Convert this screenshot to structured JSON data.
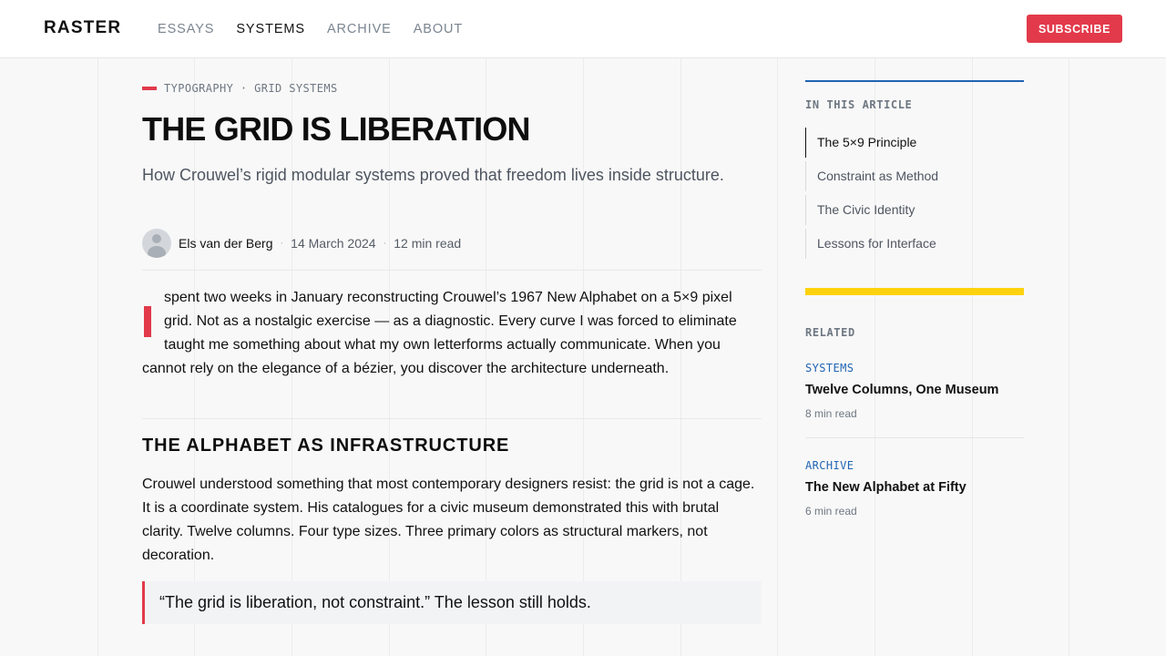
{
  "header": {
    "logo": "RASTER",
    "nav": [
      {
        "label": "ESSAYS",
        "active": false
      },
      {
        "label": "SYSTEMS",
        "active": true
      },
      {
        "label": "ARCHIVE",
        "active": false
      },
      {
        "label": "ABOUT",
        "active": false
      }
    ],
    "subscribe_label": "SUBSCRIBE"
  },
  "article": {
    "kicker": "TYPOGRAPHY · GRID SYSTEMS",
    "title": "THE GRID IS LIBERATION",
    "subtitle": "How Crouwel’s rigid modular systems proved that freedom lives inside structure.",
    "author": "Els van der Berg",
    "date": "14 March 2024",
    "read_time": "12 min read",
    "lede": "spent two weeks in January reconstructing Crouwel’s 1967 New Alphabet on a 5×9 pixel grid. Not as a nostalgic exercise — as a diagnostic. Every curve I was forced to eliminate taught me something about what my own letterforms actually communicate. When you cannot rely on the elegance of a bézier, you discover the architecture underneath.",
    "section_heading": "THE ALPHABET AS INFRASTRUCTURE",
    "paragraph": "Crouwel understood something that most contemporary designers resist: the grid is not a cage. It is a coordinate system. His catalogues for a civic museum demonstrated this with brutal clarity. Twelve columns. Four type sizes. Three primary colors as structural markers, not decoration.",
    "pullquote": "“The grid is liberation, not constraint.” The lesson still holds."
  },
  "sidebar": {
    "toc_label": "IN THIS ARTICLE",
    "toc": [
      {
        "label": "The 5×9 Principle",
        "active": true
      },
      {
        "label": "Constraint as Method",
        "active": false
      },
      {
        "label": "The Civic Identity",
        "active": false
      },
      {
        "label": "Lessons for Interface",
        "active": false
      }
    ],
    "related_label": "RELATED",
    "related": [
      {
        "category": "SYSTEMS",
        "title": "Twelve Columns, One Museum",
        "read_time": "8 min read"
      },
      {
        "category": "ARCHIVE",
        "title": "The New Alphabet at Fifty",
        "read_time": "6 min read"
      }
    ]
  },
  "colors": {
    "accent_red": "#e23a4a",
    "accent_blue": "#2165b3",
    "accent_yellow": "#ffd20f"
  }
}
